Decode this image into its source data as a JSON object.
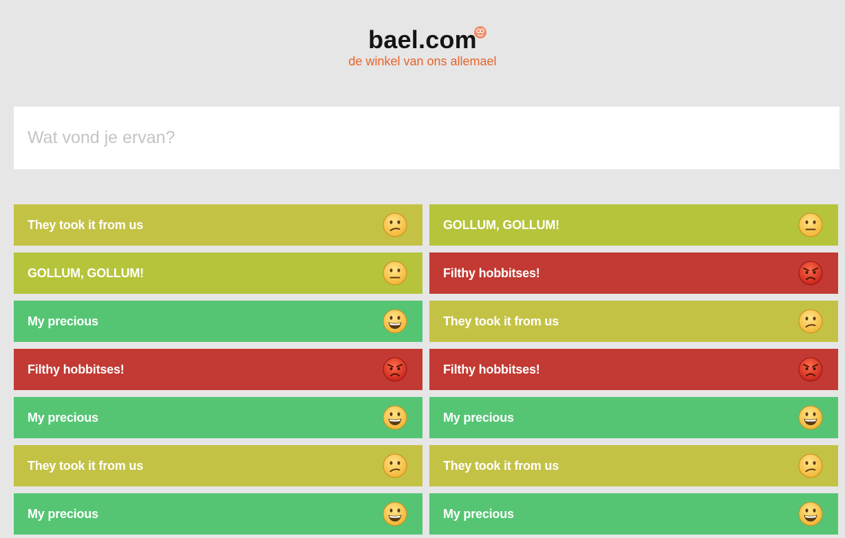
{
  "logo": {
    "wordmark": "bael.com",
    "tagline": "de winkel van ons allemael",
    "accent_color": "#e8632b"
  },
  "search": {
    "placeholder": "Wat vond je ervan?",
    "value": ""
  },
  "moods": {
    "confused": {
      "icon": "confused-face-icon",
      "color": "#c4c245"
    },
    "neutral": {
      "icon": "neutral-face-icon",
      "color": "#b5c43b"
    },
    "happy": {
      "icon": "grinning-face-icon",
      "color": "#55c574"
    },
    "angry": {
      "icon": "angry-face-icon",
      "color": "#c23a33"
    }
  },
  "reactions": [
    {
      "label": "They took it from us",
      "mood": "confused"
    },
    {
      "label": "GOLLUM, GOLLUM!",
      "mood": "neutral"
    },
    {
      "label": "GOLLUM, GOLLUM!",
      "mood": "neutral"
    },
    {
      "label": "Filthy hobbitses!",
      "mood": "angry"
    },
    {
      "label": "My precious",
      "mood": "happy"
    },
    {
      "label": "They took it from us",
      "mood": "confused"
    },
    {
      "label": "Filthy hobbitses!",
      "mood": "angry"
    },
    {
      "label": "Filthy hobbitses!",
      "mood": "angry"
    },
    {
      "label": "My precious",
      "mood": "happy"
    },
    {
      "label": "My precious",
      "mood": "happy"
    },
    {
      "label": "They took it from us",
      "mood": "confused"
    },
    {
      "label": "They took it from us",
      "mood": "confused"
    },
    {
      "label": "My precious",
      "mood": "happy"
    },
    {
      "label": "My precious",
      "mood": "happy"
    }
  ]
}
